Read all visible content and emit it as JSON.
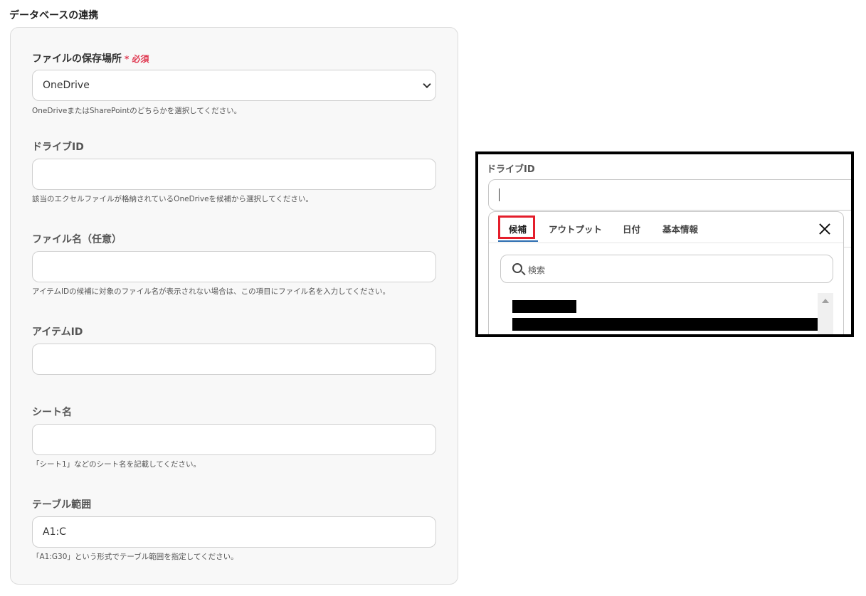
{
  "section_title": "データベースの連携",
  "fields": [
    {
      "label": "ファイルの保存場所",
      "required_label": "* 必須",
      "value": "OneDrive",
      "help": "OneDriveまたはSharePointのどちらかを選択してください。"
    },
    {
      "label": "ドライブID",
      "value": "",
      "help": "該当のエクセルファイルが格納されているOneDriveを候補から選択してください。"
    },
    {
      "label": "ファイル名（任意）",
      "value": "",
      "help": "アイテムIDの候補に対象のファイル名が表示されない場合は、この項目にファイル名を入力してください。"
    },
    {
      "label": "アイテムID",
      "value": "",
      "help": ""
    },
    {
      "label": "シート名",
      "value": "",
      "help": "「シート1」などのシート名を記載してください。"
    },
    {
      "label": "テーブル範囲",
      "value": "A1:C",
      "help": "「A1:G30」という形式でテーブル範囲を指定してください。"
    }
  ],
  "popup": {
    "label": "ドライブID",
    "tabs": [
      "候補",
      "アウトプット",
      "日付",
      "基本情報"
    ],
    "active_tab": "候補",
    "search_placeholder": "検索"
  },
  "colors": {
    "required": "#e03a52",
    "highlight": "#e41e2b",
    "tab_underline": "#2b6cb0"
  }
}
